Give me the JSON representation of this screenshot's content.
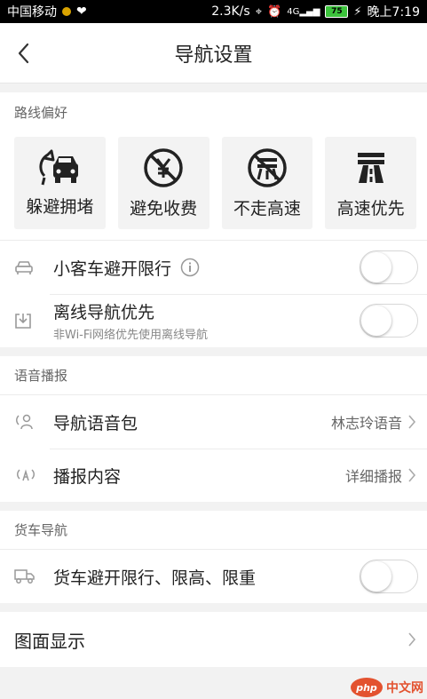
{
  "status_bar": {
    "carrier": "中国移动",
    "speed": "2.3K/s",
    "network": "4G",
    "battery": "75",
    "time": "晚上7:19"
  },
  "header": {
    "title": "导航设置"
  },
  "route_preference": {
    "section_title": "路线偏好",
    "options": [
      {
        "label": "躲避拥堵",
        "icon": "avoid-congestion-icon"
      },
      {
        "label": "避免收费",
        "icon": "no-toll-icon"
      },
      {
        "label": "不走高速",
        "icon": "no-highway-icon"
      },
      {
        "label": "高速优先",
        "icon": "highway-first-icon"
      }
    ],
    "car_restriction": {
      "label": "小客车避开限行",
      "enabled": false
    },
    "offline_first": {
      "label": "离线导航优先",
      "sublabel": "非Wi-Fi网络优先使用离线导航",
      "enabled": false
    }
  },
  "voice": {
    "section_title": "语音播报",
    "voice_pack": {
      "label": "导航语音包",
      "value": "林志玲语音"
    },
    "broadcast": {
      "label": "播报内容",
      "value": "详细播报"
    }
  },
  "truck": {
    "section_title": "货车导航",
    "restriction": {
      "label": "货车避开限行、限高、限重",
      "enabled": false
    }
  },
  "map_display": {
    "label": "图面显示"
  },
  "watermark": {
    "logo": "php",
    "text": "中文网"
  },
  "colors": {
    "accent": "#e3522f",
    "icon": "#222222",
    "muted_icon": "#999999"
  }
}
